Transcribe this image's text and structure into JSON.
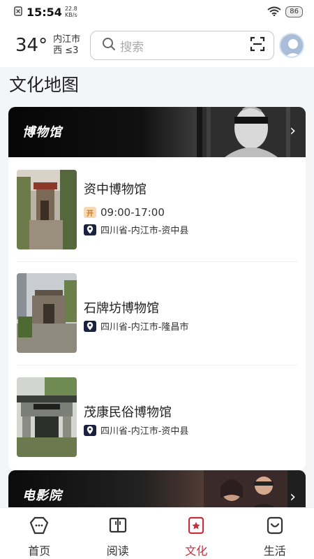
{
  "status_bar": {
    "time": "15:54",
    "speed_value": "22.8",
    "speed_unit": "KB/s",
    "battery": "86"
  },
  "header": {
    "temperature": "34°",
    "city": "内江市",
    "wind": "西 ≤3",
    "search_placeholder": "搜索"
  },
  "page_title": "文化地图",
  "museum_section": {
    "title": "博物馆",
    "items": [
      {
        "name": "资中博物馆",
        "open_badge": "开",
        "hours": "09:00-17:00",
        "address": "四川省-内江市-资中县"
      },
      {
        "name": "石牌坊博物馆",
        "address": "四川省-内江市-隆昌市"
      },
      {
        "name": "茂康民俗博物馆",
        "address": "四川省-内江市-资中县"
      }
    ]
  },
  "cinema_section": {
    "title": "电影院"
  },
  "tab_bar": {
    "tabs": [
      {
        "label": "首页",
        "icon": "home-icon"
      },
      {
        "label": "阅读",
        "icon": "book-icon"
      },
      {
        "label": "文化",
        "icon": "culture-icon",
        "active": true
      },
      {
        "label": "生活",
        "icon": "life-icon"
      }
    ]
  },
  "colors": {
    "accent": "#c2313d",
    "pin_bg": "#1b2240",
    "open_badge_bg": "#f7d9b4"
  }
}
